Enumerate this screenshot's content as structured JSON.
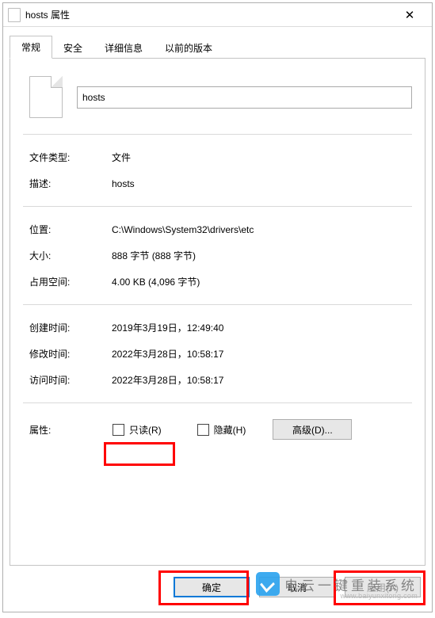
{
  "window": {
    "title": "hosts 属性",
    "close_glyph": "✕"
  },
  "tabs": {
    "general": "常规",
    "security": "安全",
    "details": "详细信息",
    "previous": "以前的版本"
  },
  "filename": "hosts",
  "rows": {
    "type": {
      "label": "文件类型:",
      "value": "文件"
    },
    "desc": {
      "label": "描述:",
      "value": "hosts"
    },
    "location": {
      "label": "位置:",
      "value": "C:\\Windows\\System32\\drivers\\etc"
    },
    "size": {
      "label": "大小:",
      "value": "888 字节 (888 字节)"
    },
    "ondisk": {
      "label": "占用空间:",
      "value": "4.00 KB (4,096 字节)"
    },
    "created": {
      "label": "创建时间:",
      "value": "2019年3月19日，12:49:40"
    },
    "modified": {
      "label": "修改时间:",
      "value": "2022年3月28日，10:58:17"
    },
    "accessed": {
      "label": "访问时间:",
      "value": "2022年3月28日，10:58:17"
    },
    "attrs": {
      "label": "属性:",
      "readonly": "只读(R)",
      "hidden": "隐藏(H)",
      "advanced": "高级(D)..."
    }
  },
  "footer": {
    "ok": "确定",
    "cancel": "取消",
    "apply": "应用(A)"
  },
  "watermark": {
    "line1": "电云一键重装系统",
    "line2": "www.baiyunxitong.com"
  }
}
